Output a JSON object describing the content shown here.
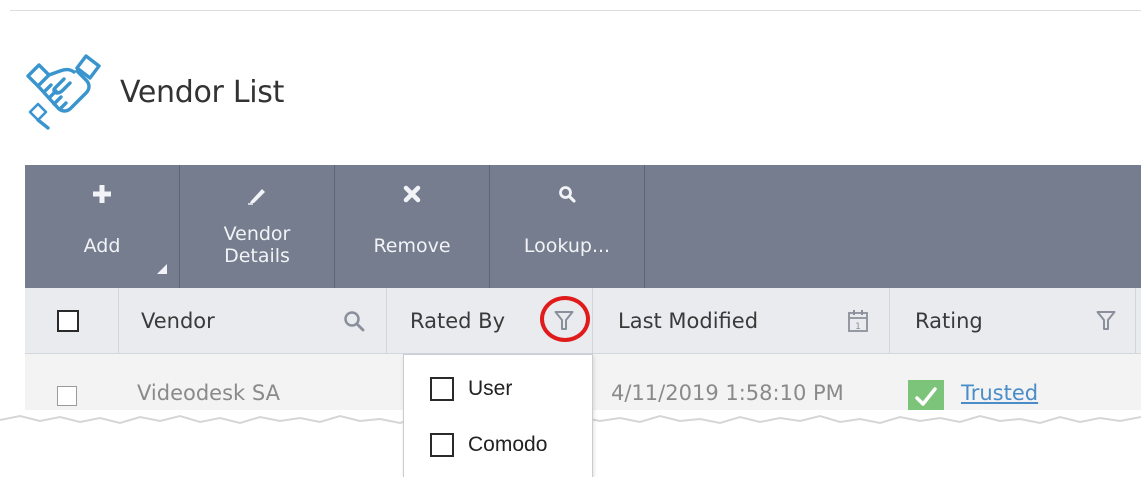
{
  "page": {
    "title": "Vendor List"
  },
  "toolbar": {
    "buttons": [
      {
        "label": "Add",
        "icon": "plus-icon"
      },
      {
        "label": "Vendor\nDetails",
        "icon": "pencil-icon"
      },
      {
        "label": "Remove",
        "icon": "x-icon"
      },
      {
        "label": "Lookup...",
        "icon": "search-icon"
      }
    ]
  },
  "table": {
    "columns": [
      "Vendor",
      "Rated By",
      "Last Modified",
      "Rating"
    ],
    "rows": [
      {
        "vendor": "Videodesk SA",
        "last_modified": "4/11/2019 1:58:10 PM",
        "rating": "Trusted"
      }
    ]
  },
  "rated_by_filter": {
    "options": [
      "User",
      "Comodo"
    ]
  },
  "colors": {
    "toolbar": "#757d8e",
    "header": "#e9ebef",
    "highlight": "#e01b1b",
    "trusted": "#7cc47a",
    "link": "#4a8cc8",
    "icon_blue": "#3a95cf"
  }
}
